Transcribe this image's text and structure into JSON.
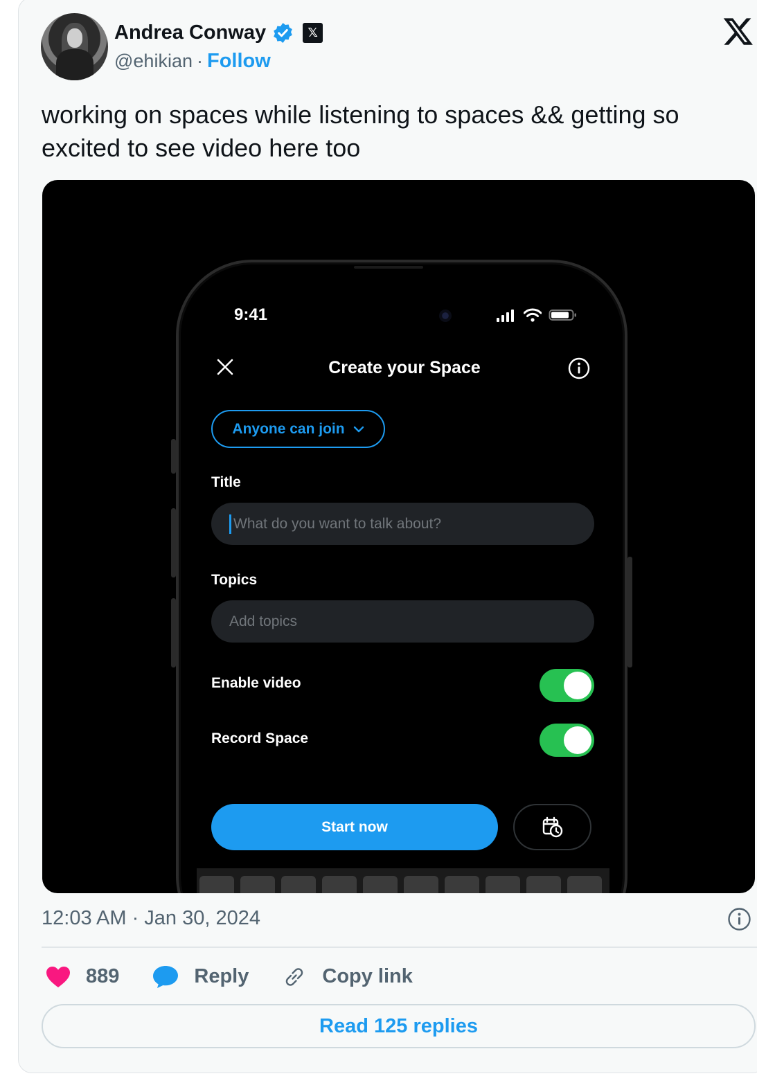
{
  "tweet": {
    "author_name": "Andrea Conway",
    "handle": "@ehikian",
    "separator": "·",
    "follow_label": "Follow",
    "text": "working on spaces while listening to spaces && getting so excited to see video here too",
    "timestamp": "12:03 AM · Jan 30, 2024",
    "likes": "889",
    "reply_label": "Reply",
    "copy_link_label": "Copy link",
    "read_replies_label": "Read 125 replies"
  },
  "phone_screen": {
    "status_time": "9:41",
    "title": "Create your Space",
    "audience_label": "Anyone can join",
    "title_label": "Title",
    "title_placeholder": "What do you want to talk about?",
    "topics_label": "Topics",
    "topics_placeholder": "Add topics",
    "enable_video_label": "Enable video",
    "enable_video_on": true,
    "record_space_label": "Record Space",
    "record_space_on": true,
    "start_label": "Start now"
  },
  "colors": {
    "accent": "#1d9bf0",
    "like": "#f91880",
    "toggle_on": "#27c152",
    "muted": "#536471"
  }
}
